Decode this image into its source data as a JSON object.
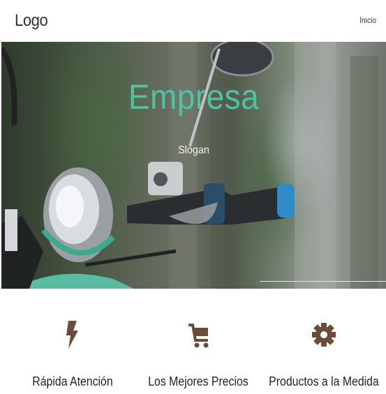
{
  "header": {
    "logo": "Logo",
    "nav": [
      {
        "label": "Inicio"
      }
    ]
  },
  "hero": {
    "title": "Empresa",
    "slogan": "Slogan",
    "title_color": "#4fc2a2"
  },
  "features": [
    {
      "icon": "lightning-icon",
      "label": "Rápida Atención"
    },
    {
      "icon": "cart-icon",
      "label": "Los Mejores Precios"
    },
    {
      "icon": "gear-icon",
      "label": "Productos a la Medida"
    }
  ],
  "colors": {
    "accent": "#4fc2a2",
    "icon": "#6b4b3a"
  }
}
